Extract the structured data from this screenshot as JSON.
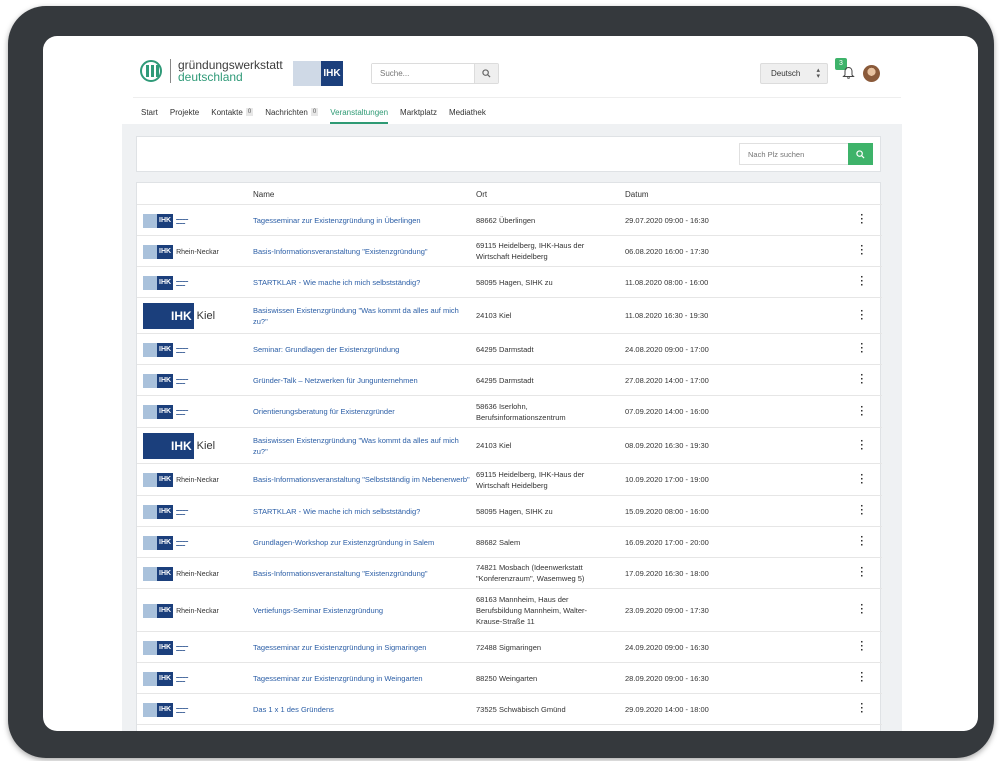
{
  "header": {
    "logo_line1": "gründungswerkstatt",
    "logo_line2": "deutschland",
    "ihk_logo_text": "IHK",
    "search_placeholder": "Suche...",
    "language": "Deutsch",
    "notification_count": "3"
  },
  "nav": [
    {
      "label": "Start",
      "count": ""
    },
    {
      "label": "Projekte",
      "count": ""
    },
    {
      "label": "Kontakte",
      "count": "0"
    },
    {
      "label": "Nachrichten",
      "count": "0"
    },
    {
      "label": "Veranstaltungen",
      "count": "",
      "active": true
    },
    {
      "label": "Marktplatz",
      "count": ""
    },
    {
      "label": "Mediathek",
      "count": ""
    }
  ],
  "filter": {
    "plz_placeholder": "Nach Plz suchen"
  },
  "table": {
    "headers": {
      "name": "Name",
      "ort": "Ort",
      "datum": "Datum"
    },
    "rows": [
      {
        "logo": "bodensee",
        "name": "Tagesseminar zur Existenzgründung in Überlingen",
        "ort": "88662 Überlingen",
        "datum": "29.07.2020 09:00 - 16:30"
      },
      {
        "logo": "rhein-neckar",
        "name": "Basis-Informationsveranstaltung \"Existenzgründung\"",
        "ort": "69115 Heidelberg, IHK-Haus der Wirtschaft Heidelberg",
        "datum": "06.08.2020 16:00 - 17:30"
      },
      {
        "logo": "hagen",
        "name": "STARTKLAR - Wie mache ich mich selbstständig?",
        "ort": "58095 Hagen, SIHK zu",
        "datum": "11.08.2020 08:00 - 16:00"
      },
      {
        "logo": "kiel",
        "name": "Basiswissen Existenzgründung \"Was kommt da alles auf mich zu?\"",
        "ort": "24103 Kiel",
        "datum": "11.08.2020 16:30 - 19:30"
      },
      {
        "logo": "darmstadt",
        "name": "Seminar: Grundlagen der Existenzgründung",
        "ort": "64295 Darmstadt",
        "datum": "24.08.2020 09:00 - 17:00"
      },
      {
        "logo": "darmstadt",
        "name": "Gründer-Talk – Netzwerken für Jungunternehmen",
        "ort": "64295 Darmstadt",
        "datum": "27.08.2020 14:00 - 17:00"
      },
      {
        "logo": "hagen",
        "name": "Orientierungsberatung für Existenzgründer",
        "ort": "58636 Iserlohn, Berufsinformationszentrum",
        "datum": "07.09.2020 14:00 - 16:00"
      },
      {
        "logo": "kiel",
        "name": "Basiswissen Existenzgründung \"Was kommt da alles auf mich zu?\"",
        "ort": "24103 Kiel",
        "datum": "08.09.2020 16:30 - 19:30"
      },
      {
        "logo": "rhein-neckar",
        "name": "Basis-Informationsveranstaltung \"Selbstständig im Nebenerwerb\"",
        "ort": "69115 Heidelberg, IHK-Haus der Wirtschaft Heidelberg",
        "datum": "10.09.2020 17:00 - 19:00"
      },
      {
        "logo": "hagen",
        "name": "STARTKLAR - Wie mache ich mich selbstständig?",
        "ort": "58095 Hagen, SIHK zu",
        "datum": "15.09.2020 08:00 - 16:00"
      },
      {
        "logo": "bodensee",
        "name": "Grundlagen-Workshop zur Existenzgründung in Salem",
        "ort": "88682 Salem",
        "datum": "16.09.2020 17:00 - 20:00"
      },
      {
        "logo": "rhein-neckar",
        "name": "Basis-Informationsveranstaltung \"Existenzgründung\"",
        "ort": "74821 Mosbach (Ideenwerkstatt \"Konferenzraum\", Wasemweg 5)",
        "datum": "17.09.2020 16:30 - 18:00"
      },
      {
        "logo": "rhein-neckar",
        "name": "Vertiefungs-Seminar Existenzgründung",
        "ort": "68163 Mannheim, Haus der Berufsbildung Mannheim, Walter-Krause-Straße 11",
        "datum": "23.09.2020 09:00 - 17:30"
      },
      {
        "logo": "bodensee",
        "name": "Tagesseminar zur Existenzgründung in Sigmaringen",
        "ort": "72488 Sigmaringen",
        "datum": "24.09.2020 09:00 - 16:30"
      },
      {
        "logo": "bodensee",
        "name": "Tagesseminar zur Existenzgründung in Weingarten",
        "ort": "88250 Weingarten",
        "datum": "28.09.2020 09:00 - 16:30"
      },
      {
        "logo": "ostwuerttemberg",
        "name": "Das 1 x 1 des Gründens",
        "ort": "73525 Schwäbisch Gmünd",
        "datum": "29.09.2020 14:00 - 18:00"
      }
    ]
  },
  "logo_texts": {
    "ihk": "IHK",
    "rhein_neckar": "Rhein-Neckar",
    "kiel": "Kiel"
  },
  "colors": {
    "accent": "#3eb36a",
    "link": "#2b5ea6",
    "ihk_blue": "#1b3f7c"
  },
  "icons": {
    "search": "magnifier-icon",
    "bell": "bell-icon",
    "menu": "kebab-menu-icon"
  }
}
